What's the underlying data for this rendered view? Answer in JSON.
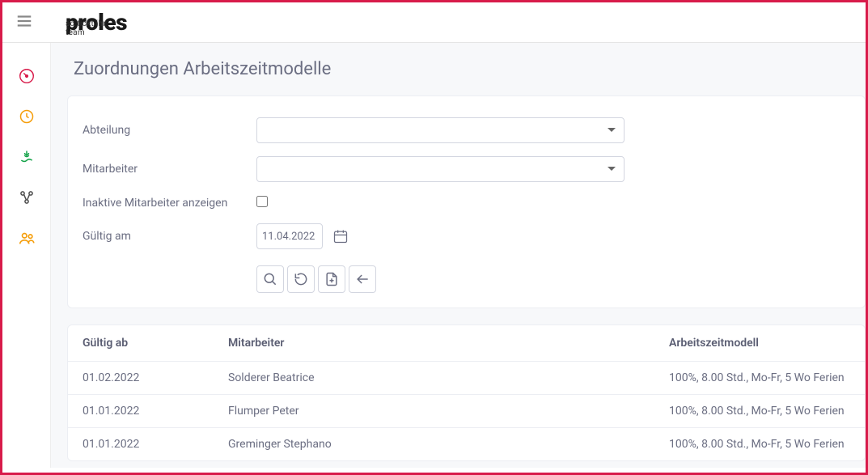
{
  "header": {
    "logo": "proles",
    "logo_sub": "so tickt ihr team"
  },
  "page": {
    "title": "Zuordnungen Arbeitszeitmodelle"
  },
  "form": {
    "abteilung_label": "Abteilung",
    "mitarbeiter_label": "Mitarbeiter",
    "inaktiv_label": "Inaktive Mitarbeiter anzeigen",
    "gueltig_am_label": "Gültig am",
    "gueltig_am_value": "11.04.2022"
  },
  "table": {
    "headers": {
      "gueltig_ab": "Gültig ab",
      "mitarbeiter": "Mitarbeiter",
      "modell": "Arbeitszeitmodell"
    },
    "rows": [
      {
        "gueltig_ab": "01.02.2022",
        "mitarbeiter": "Solderer Beatrice",
        "modell": "100%, 8.00 Std., Mo-Fr, 5 Wo Ferien"
      },
      {
        "gueltig_ab": "01.01.2022",
        "mitarbeiter": "Flumper Peter",
        "modell": "100%, 8.00 Std., Mo-Fr, 5 Wo Ferien"
      },
      {
        "gueltig_ab": "01.01.2022",
        "mitarbeiter": "Greminger Stephano",
        "modell": "100%, 8.00 Std., Mo-Fr, 5 Wo Ferien"
      }
    ]
  }
}
